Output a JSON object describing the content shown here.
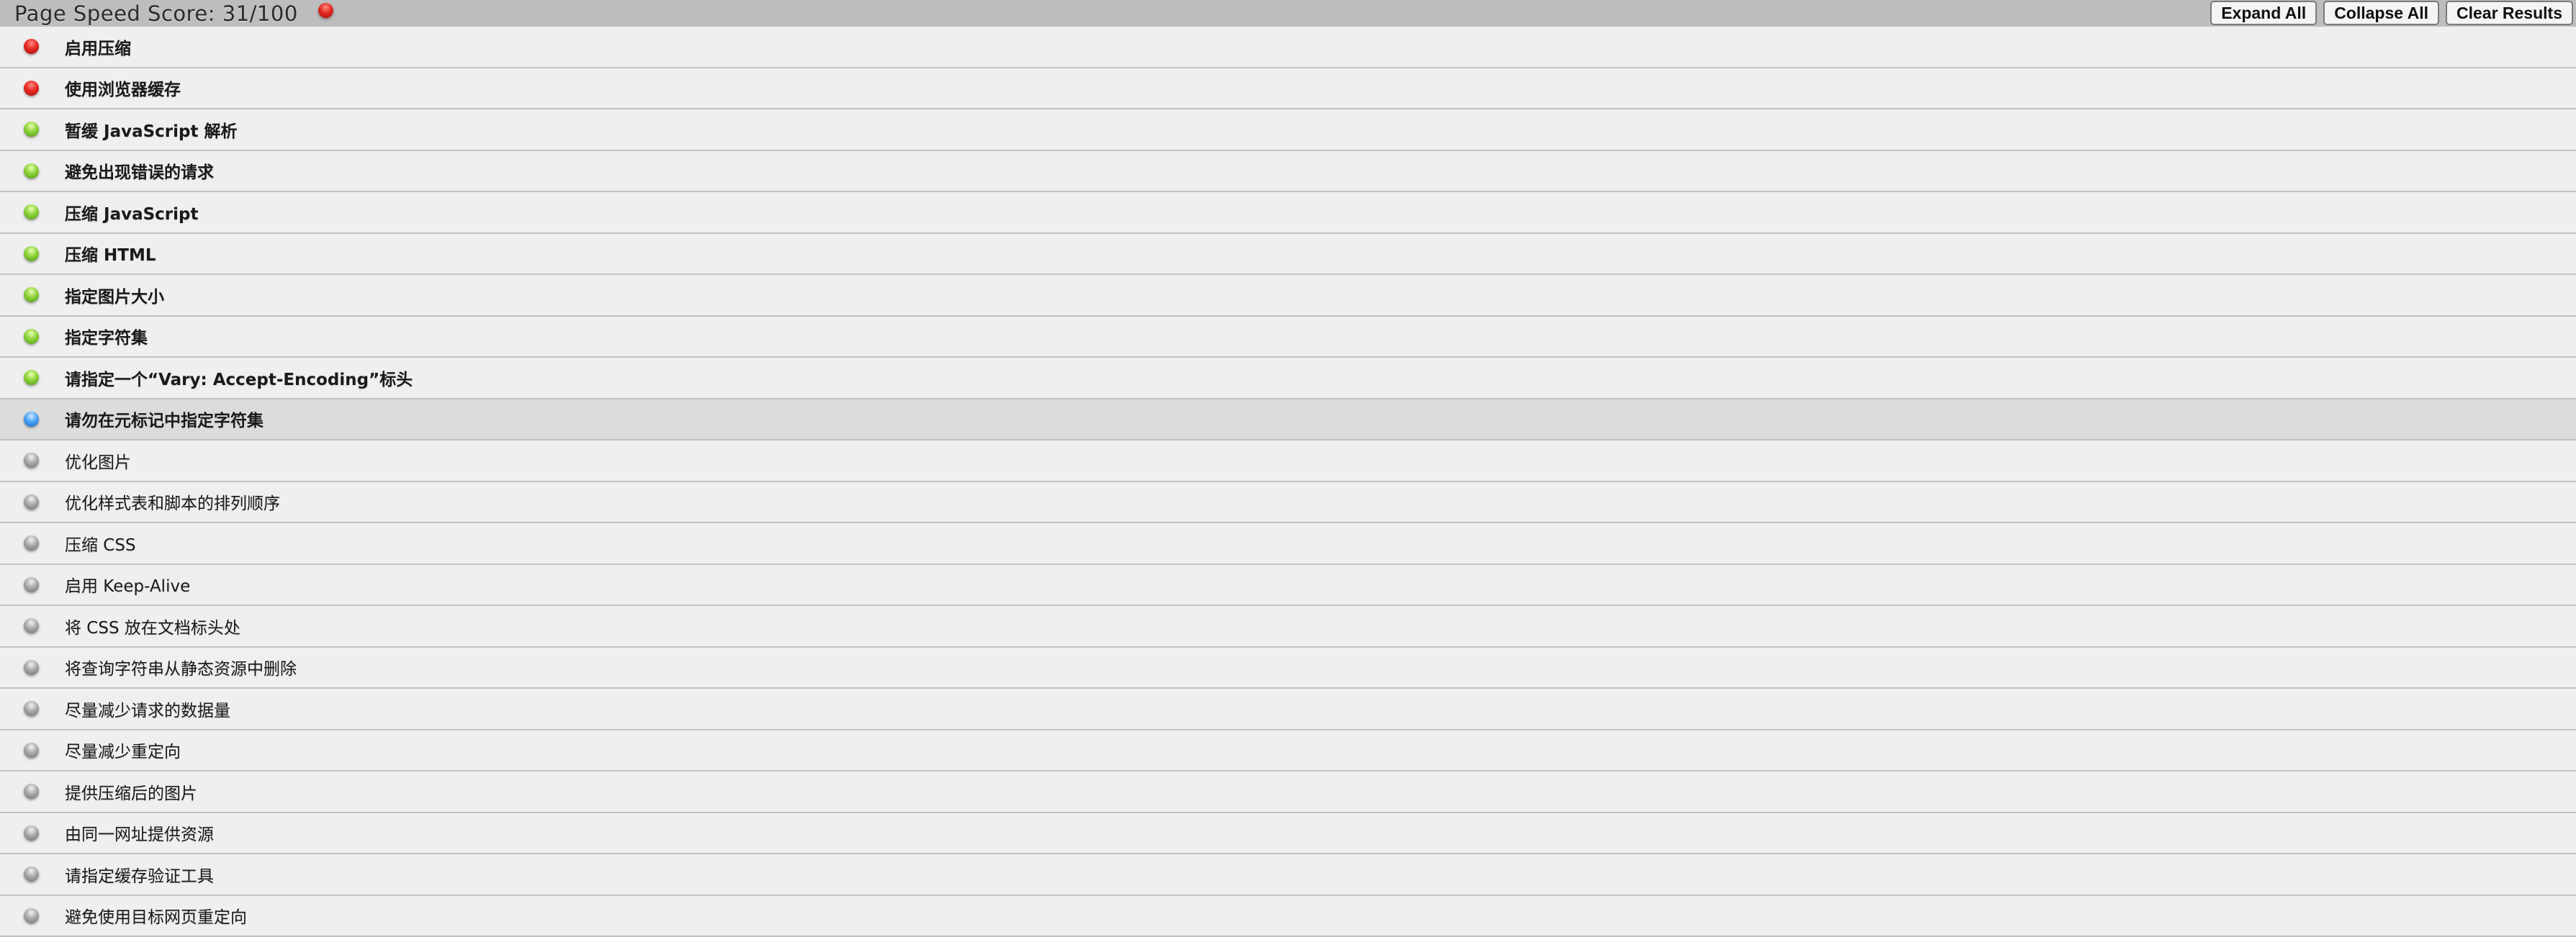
{
  "header": {
    "score_label": "Page Speed Score: 31/100",
    "score_status": "red",
    "buttons": {
      "expand_all": "Expand All",
      "collapse_all": "Collapse All",
      "clear_results": "Clear Results"
    }
  },
  "rules": [
    {
      "label": "启用压缩",
      "status": "red",
      "bold": true
    },
    {
      "label": "使用浏览器缓存",
      "status": "red",
      "bold": true
    },
    {
      "label": "暂缓 JavaScript 解析",
      "status": "green",
      "bold": true
    },
    {
      "label": "避免出现错误的请求",
      "status": "green",
      "bold": true
    },
    {
      "label": "压缩 JavaScript",
      "status": "green",
      "bold": true
    },
    {
      "label": "压缩 HTML",
      "status": "green",
      "bold": true
    },
    {
      "label": "指定图片大小",
      "status": "green",
      "bold": true
    },
    {
      "label": "指定字符集",
      "status": "green",
      "bold": true
    },
    {
      "label": "请指定一个“Vary: Accept-Encoding”标头",
      "status": "green",
      "bold": true
    },
    {
      "label": "请勿在元标记中指定字符集",
      "status": "blue",
      "bold": true,
      "selected": true
    },
    {
      "label": "优化图片",
      "status": "gray",
      "bold": false
    },
    {
      "label": "优化样式表和脚本的排列顺序",
      "status": "gray",
      "bold": false
    },
    {
      "label": "压缩 CSS",
      "status": "gray",
      "bold": false
    },
    {
      "label": "启用 Keep-Alive",
      "status": "gray",
      "bold": false
    },
    {
      "label": "将 CSS 放在文档标头处",
      "status": "gray",
      "bold": false
    },
    {
      "label": "将查询字符串从静态资源中删除",
      "status": "gray",
      "bold": false
    },
    {
      "label": "尽量减少请求的数据量",
      "status": "gray",
      "bold": false
    },
    {
      "label": "尽量减少重定向",
      "status": "gray",
      "bold": false
    },
    {
      "label": "提供压缩后的图片",
      "status": "gray",
      "bold": false
    },
    {
      "label": "由同一网址提供资源",
      "status": "gray",
      "bold": false
    },
    {
      "label": "请指定缓存验证工具",
      "status": "gray",
      "bold": false
    },
    {
      "label": "避免使用目标网页重定向",
      "status": "gray",
      "bold": false
    }
  ]
}
